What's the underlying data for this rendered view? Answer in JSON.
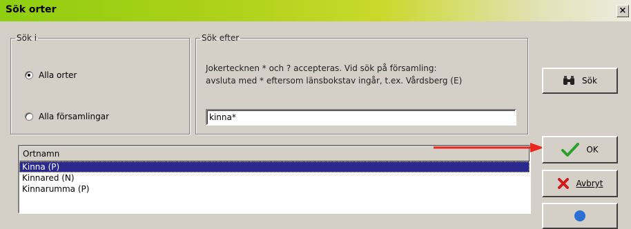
{
  "window": {
    "title": "Sök orter",
    "close_label": "×"
  },
  "search_in": {
    "legend": "Sök i",
    "options": [
      {
        "label": "Alla orter",
        "selected": true
      },
      {
        "label": "Alla församlingar",
        "selected": false
      }
    ]
  },
  "search_for": {
    "legend": "Sök efter",
    "hint_line1": "Jokertecknen * och ? accepteras. Vid sök på församling:",
    "hint_line2": "avsluta med * eftersom länsbokstav ingår, t.ex. Vårdsberg (E)",
    "value": "kinna*"
  },
  "buttons": {
    "search_label": "Sök",
    "ok_label": "OK",
    "cancel_label": "Avbryt",
    "search_icon": "binoculars-icon",
    "ok_icon": "checkmark-icon",
    "cancel_icon": "x-icon"
  },
  "results": {
    "column_header": "Ortnamn",
    "rows": [
      "Kinna (P)",
      "Kinnared (N)",
      "Kinnarumma (P)"
    ],
    "selected_index": 0
  },
  "colors": {
    "selection": "#2a2a8e",
    "annotation_arrow": "#e8261c",
    "ok_check": "#2aa12a",
    "cancel_x": "#d11a1a"
  }
}
